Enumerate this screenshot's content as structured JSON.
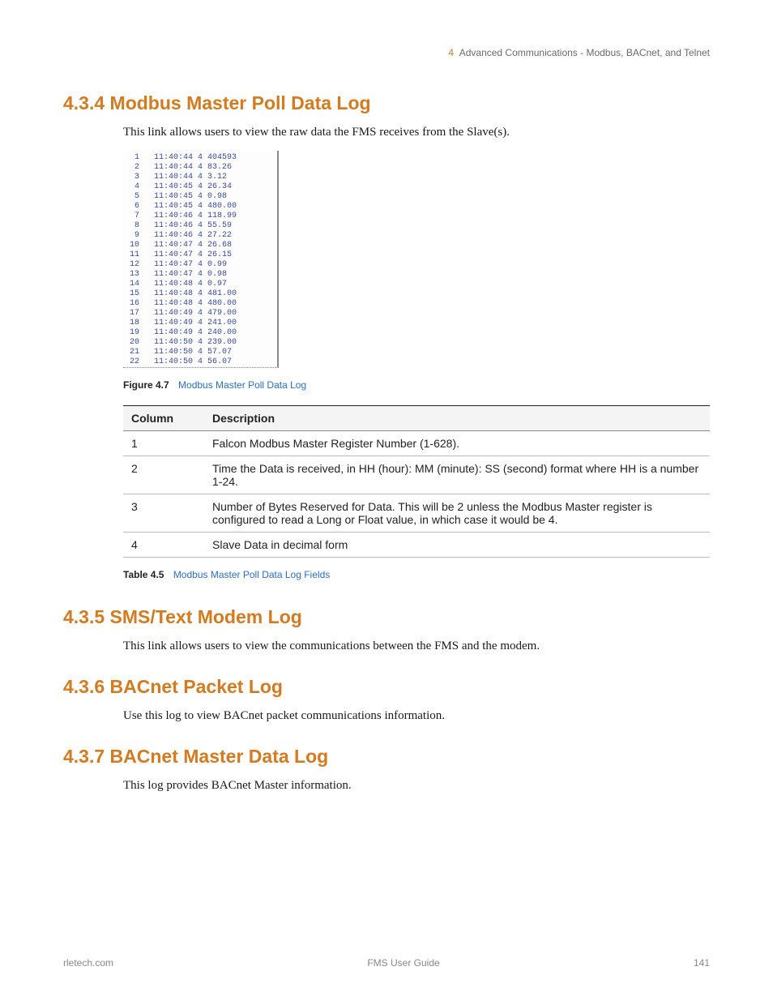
{
  "header": {
    "chapter_number": "4",
    "chapter_title": "Advanced Communications - Modbus, BACnet, and Telnet"
  },
  "sections": {
    "s434": {
      "heading": "4.3.4 Modbus Master Poll Data Log",
      "intro": "This link allows users to view the raw data the FMS receives from the Slave(s)."
    },
    "s435": {
      "heading": "4.3.5 SMS/Text Modem Log",
      "intro": "This link allows users to view the communications between the FMS and the modem."
    },
    "s436": {
      "heading": "4.3.6 BACnet Packet Log",
      "intro": "Use this log to view BACnet packet communications information."
    },
    "s437": {
      "heading": "4.3.7 BACnet Master Data Log",
      "intro": "This log provides BACnet Master information."
    }
  },
  "figure": {
    "label": "Figure 4.7",
    "title": "Modbus Master Poll Data Log",
    "rows": [
      {
        "n": "1",
        "t": "11:40:44",
        "b": "4",
        "v": "404593"
      },
      {
        "n": "2",
        "t": "11:40:44",
        "b": "4",
        "v": "83.26"
      },
      {
        "n": "3",
        "t": "11:40:44",
        "b": "4",
        "v": "3.12"
      },
      {
        "n": "4",
        "t": "11:40:45",
        "b": "4",
        "v": "26.34"
      },
      {
        "n": "5",
        "t": "11:40:45",
        "b": "4",
        "v": "0.98"
      },
      {
        "n": "6",
        "t": "11:40:45",
        "b": "4",
        "v": "480.00"
      },
      {
        "n": "7",
        "t": "11:40:46",
        "b": "4",
        "v": "118.99"
      },
      {
        "n": "8",
        "t": "11:40:46",
        "b": "4",
        "v": "55.59"
      },
      {
        "n": "9",
        "t": "11:40:46",
        "b": "4",
        "v": "27.22"
      },
      {
        "n": "10",
        "t": "11:40:47",
        "b": "4",
        "v": "26.68"
      },
      {
        "n": "11",
        "t": "11:40:47",
        "b": "4",
        "v": "26.15"
      },
      {
        "n": "12",
        "t": "11:40:47",
        "b": "4",
        "v": "0.99"
      },
      {
        "n": "13",
        "t": "11:40:47",
        "b": "4",
        "v": "0.98"
      },
      {
        "n": "14",
        "t": "11:40:48",
        "b": "4",
        "v": "0.97"
      },
      {
        "n": "15",
        "t": "11:40:48",
        "b": "4",
        "v": "481.00"
      },
      {
        "n": "16",
        "t": "11:40:48",
        "b": "4",
        "v": "480.00"
      },
      {
        "n": "17",
        "t": "11:40:49",
        "b": "4",
        "v": "479.00"
      },
      {
        "n": "18",
        "t": "11:40:49",
        "b": "4",
        "v": "241.00"
      },
      {
        "n": "19",
        "t": "11:40:49",
        "b": "4",
        "v": "240.00"
      },
      {
        "n": "20",
        "t": "11:40:50",
        "b": "4",
        "v": "239.00"
      },
      {
        "n": "21",
        "t": "11:40:50",
        "b": "4",
        "v": "57.07"
      },
      {
        "n": "22",
        "t": "11:40:50",
        "b": "4",
        "v": "56.07"
      }
    ]
  },
  "table": {
    "label": "Table 4.5",
    "title": "Modbus Master Poll Data Log Fields",
    "headers": {
      "col1": "Column",
      "col2": "Description"
    },
    "rows": [
      {
        "c": "1",
        "d": "Falcon Modbus Master Register Number (1-628)."
      },
      {
        "c": "2",
        "d": "Time the Data is received, in HH (hour): MM (minute): SS (second) format where HH is a number 1-24."
      },
      {
        "c": "3",
        "d": "Number of Bytes Reserved for Data. This will be 2 unless the Modbus Master register is configured to read a Long or Float value, in which case it would be 4."
      },
      {
        "c": "4",
        "d": "Slave Data in decimal form"
      }
    ]
  },
  "footer": {
    "left": "rletech.com",
    "center": "FMS User Guide",
    "right": "141"
  }
}
